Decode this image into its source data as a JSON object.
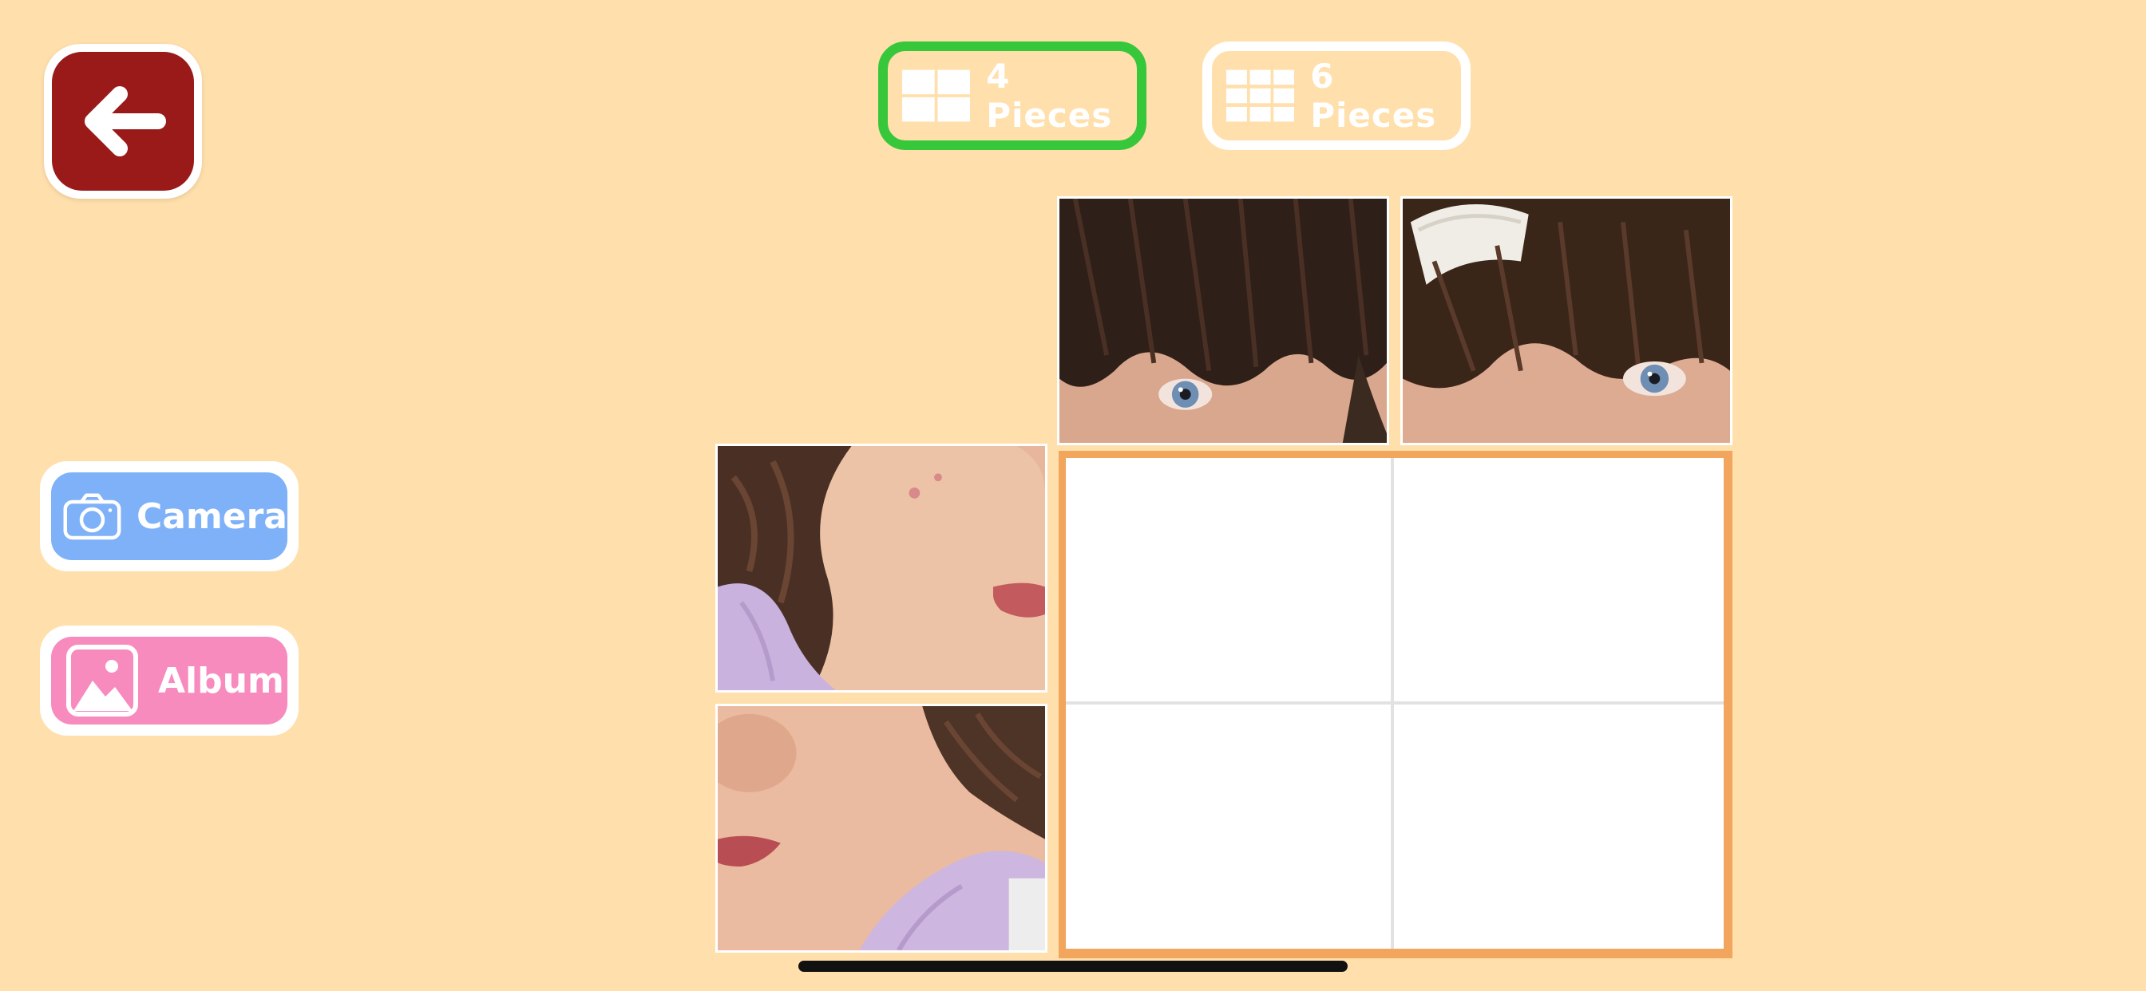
{
  "back_button": {
    "icon": "arrow-left-icon",
    "color": "#9A1A1A"
  },
  "piece_options": [
    {
      "label": "4 Pieces",
      "icon": "grid-icon",
      "selected": true,
      "border_color": "#36C73A"
    },
    {
      "label": "6 Pieces",
      "icon": "grid-icon",
      "selected": false,
      "border_color": "#FFFFFF"
    }
  ],
  "sources": {
    "camera": {
      "label": "Camera",
      "icon": "camera-icon",
      "color": "#7FB1F8"
    },
    "album": {
      "label": "Album",
      "icon": "photo-icon",
      "color": "#F88BBE"
    }
  },
  "puzzle": {
    "total_pieces": 4,
    "placed_pieces": 0,
    "loose_pieces": [
      {
        "content": "eyes-left"
      },
      {
        "content": "eyes-right-hat"
      },
      {
        "content": "cheek-lips-right"
      },
      {
        "content": "nose-lips-left"
      }
    ],
    "board_color": "#F2A55C"
  },
  "colors": {
    "background": "#FFDFAB"
  }
}
